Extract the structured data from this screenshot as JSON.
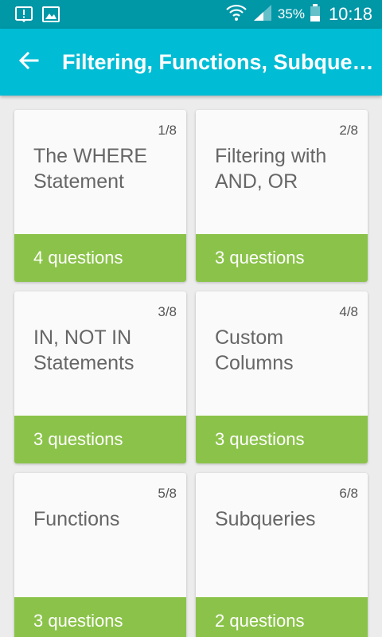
{
  "status_bar": {
    "battery": "35%",
    "time": "10:18",
    "icons": [
      "alert-notification-icon",
      "image-notification-icon",
      "wifi-icon",
      "signal-icon",
      "battery-icon"
    ]
  },
  "app_bar": {
    "title": "Filtering, Functions, Subque…",
    "back_icon": "arrow-back-icon"
  },
  "colors": {
    "status_bar": "#0097a7",
    "app_bar": "#00bcd4",
    "card_footer": "#8bc34a",
    "background": "#ececec"
  },
  "cards": [
    {
      "number": "1/8",
      "title": "The WHERE Statement",
      "questions": "4 questions"
    },
    {
      "number": "2/8",
      "title": "Filtering with AND, OR",
      "questions": "3 questions"
    },
    {
      "number": "3/8",
      "title": "IN, NOT IN Statements",
      "questions": "3 questions"
    },
    {
      "number": "4/8",
      "title": "Custom Columns",
      "questions": "3 questions"
    },
    {
      "number": "5/8",
      "title": "Functions",
      "questions": "3 questions"
    },
    {
      "number": "6/8",
      "title": "Subqueries",
      "questions": "2 questions"
    }
  ]
}
